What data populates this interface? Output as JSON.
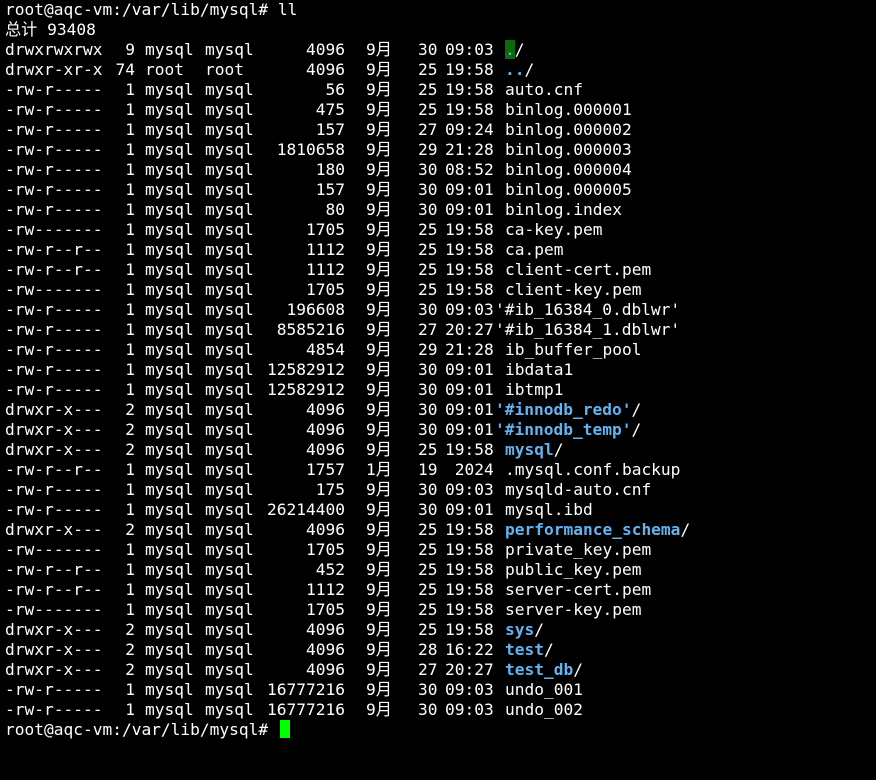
{
  "terminal": {
    "prompt": "root@aqc-vm:/var/lib/mysql#",
    "command": "ll",
    "total": "总计 93408",
    "entries": [
      {
        "perm": "drwxrwxrwx",
        "links": "9",
        "owner": "mysql",
        "group": "mysql",
        "size": "4096",
        "month": "9月",
        "day": "30",
        "time": "09:03",
        "name": ".",
        "suffix": "/",
        "type": "dir-current"
      },
      {
        "perm": "drwxr-xr-x",
        "links": "74",
        "owner": "root",
        "group": "root",
        "size": "4096",
        "month": "9月",
        "day": "25",
        "time": "19:58",
        "name": "..",
        "suffix": "/",
        "type": "dir"
      },
      {
        "perm": "-rw-r-----",
        "links": "1",
        "owner": "mysql",
        "group": "mysql",
        "size": "56",
        "month": "9月",
        "day": "25",
        "time": "19:58",
        "name": "auto.cnf",
        "suffix": "",
        "type": "file"
      },
      {
        "perm": "-rw-r-----",
        "links": "1",
        "owner": "mysql",
        "group": "mysql",
        "size": "475",
        "month": "9月",
        "day": "25",
        "time": "19:58",
        "name": "binlog.000001",
        "suffix": "",
        "type": "file"
      },
      {
        "perm": "-rw-r-----",
        "links": "1",
        "owner": "mysql",
        "group": "mysql",
        "size": "157",
        "month": "9月",
        "day": "27",
        "time": "09:24",
        "name": "binlog.000002",
        "suffix": "",
        "type": "file"
      },
      {
        "perm": "-rw-r-----",
        "links": "1",
        "owner": "mysql",
        "group": "mysql",
        "size": "1810658",
        "month": "9月",
        "day": "29",
        "time": "21:28",
        "name": "binlog.000003",
        "suffix": "",
        "type": "file"
      },
      {
        "perm": "-rw-r-----",
        "links": "1",
        "owner": "mysql",
        "group": "mysql",
        "size": "180",
        "month": "9月",
        "day": "30",
        "time": "08:52",
        "name": "binlog.000004",
        "suffix": "",
        "type": "file"
      },
      {
        "perm": "-rw-r-----",
        "links": "1",
        "owner": "mysql",
        "group": "mysql",
        "size": "157",
        "month": "9月",
        "day": "30",
        "time": "09:01",
        "name": "binlog.000005",
        "suffix": "",
        "type": "file"
      },
      {
        "perm": "-rw-r-----",
        "links": "1",
        "owner": "mysql",
        "group": "mysql",
        "size": "80",
        "month": "9月",
        "day": "30",
        "time": "09:01",
        "name": "binlog.index",
        "suffix": "",
        "type": "file"
      },
      {
        "perm": "-rw-------",
        "links": "1",
        "owner": "mysql",
        "group": "mysql",
        "size": "1705",
        "month": "9月",
        "day": "25",
        "time": "19:58",
        "name": "ca-key.pem",
        "suffix": "",
        "type": "file"
      },
      {
        "perm": "-rw-r--r--",
        "links": "1",
        "owner": "mysql",
        "group": "mysql",
        "size": "1112",
        "month": "9月",
        "day": "25",
        "time": "19:58",
        "name": "ca.pem",
        "suffix": "",
        "type": "file"
      },
      {
        "perm": "-rw-r--r--",
        "links": "1",
        "owner": "mysql",
        "group": "mysql",
        "size": "1112",
        "month": "9月",
        "day": "25",
        "time": "19:58",
        "name": "client-cert.pem",
        "suffix": "",
        "type": "file"
      },
      {
        "perm": "-rw-------",
        "links": "1",
        "owner": "mysql",
        "group": "mysql",
        "size": "1705",
        "month": "9月",
        "day": "25",
        "time": "19:58",
        "name": "client-key.pem",
        "suffix": "",
        "type": "file"
      },
      {
        "perm": "-rw-r-----",
        "links": "1",
        "owner": "mysql",
        "group": "mysql",
        "size": "196608",
        "month": "9月",
        "day": "30",
        "time": "09:03",
        "name": "'#ib_16384_0.dblwr'",
        "suffix": "",
        "type": "file-quoted"
      },
      {
        "perm": "-rw-r-----",
        "links": "1",
        "owner": "mysql",
        "group": "mysql",
        "size": "8585216",
        "month": "9月",
        "day": "27",
        "time": "20:27",
        "name": "'#ib_16384_1.dblwr'",
        "suffix": "",
        "type": "file-quoted"
      },
      {
        "perm": "-rw-r-----",
        "links": "1",
        "owner": "mysql",
        "group": "mysql",
        "size": "4854",
        "month": "9月",
        "day": "29",
        "time": "21:28",
        "name": "ib_buffer_pool",
        "suffix": "",
        "type": "file"
      },
      {
        "perm": "-rw-r-----",
        "links": "1",
        "owner": "mysql",
        "group": "mysql",
        "size": "12582912",
        "month": "9月",
        "day": "30",
        "time": "09:01",
        "name": "ibdata1",
        "suffix": "",
        "type": "file"
      },
      {
        "perm": "-rw-r-----",
        "links": "1",
        "owner": "mysql",
        "group": "mysql",
        "size": "12582912",
        "month": "9月",
        "day": "30",
        "time": "09:01",
        "name": "ibtmp1",
        "suffix": "",
        "type": "file"
      },
      {
        "perm": "drwxr-x---",
        "links": "2",
        "owner": "mysql",
        "group": "mysql",
        "size": "4096",
        "month": "9月",
        "day": "30",
        "time": "09:01",
        "name": "'#innodb_redo'",
        "suffix": "/",
        "type": "dir-quoted"
      },
      {
        "perm": "drwxr-x---",
        "links": "2",
        "owner": "mysql",
        "group": "mysql",
        "size": "4096",
        "month": "9月",
        "day": "30",
        "time": "09:01",
        "name": "'#innodb_temp'",
        "suffix": "/",
        "type": "dir-quoted"
      },
      {
        "perm": "drwxr-x---",
        "links": "2",
        "owner": "mysql",
        "group": "mysql",
        "size": "4096",
        "month": "9月",
        "day": "25",
        "time": "19:58",
        "name": "mysql",
        "suffix": "/",
        "type": "dir"
      },
      {
        "perm": "-rw-r--r--",
        "links": "1",
        "owner": "mysql",
        "group": "mysql",
        "size": "1757",
        "month": "1月",
        "day": "19",
        "time": " 2024",
        "name": ".mysql.conf.backup",
        "suffix": "",
        "type": "file"
      },
      {
        "perm": "-rw-r-----",
        "links": "1",
        "owner": "mysql",
        "group": "mysql",
        "size": "175",
        "month": "9月",
        "day": "30",
        "time": "09:03",
        "name": "mysqld-auto.cnf",
        "suffix": "",
        "type": "file"
      },
      {
        "perm": "-rw-r-----",
        "links": "1",
        "owner": "mysql",
        "group": "mysql",
        "size": "26214400",
        "month": "9月",
        "day": "30",
        "time": "09:01",
        "name": "mysql.ibd",
        "suffix": "",
        "type": "file"
      },
      {
        "perm": "drwxr-x---",
        "links": "2",
        "owner": "mysql",
        "group": "mysql",
        "size": "4096",
        "month": "9月",
        "day": "25",
        "time": "19:58",
        "name": "performance_schema",
        "suffix": "/",
        "type": "dir"
      },
      {
        "perm": "-rw-------",
        "links": "1",
        "owner": "mysql",
        "group": "mysql",
        "size": "1705",
        "month": "9月",
        "day": "25",
        "time": "19:58",
        "name": "private_key.pem",
        "suffix": "",
        "type": "file"
      },
      {
        "perm": "-rw-r--r--",
        "links": "1",
        "owner": "mysql",
        "group": "mysql",
        "size": "452",
        "month": "9月",
        "day": "25",
        "time": "19:58",
        "name": "public_key.pem",
        "suffix": "",
        "type": "file"
      },
      {
        "perm": "-rw-r--r--",
        "links": "1",
        "owner": "mysql",
        "group": "mysql",
        "size": "1112",
        "month": "9月",
        "day": "25",
        "time": "19:58",
        "name": "server-cert.pem",
        "suffix": "",
        "type": "file"
      },
      {
        "perm": "-rw-------",
        "links": "1",
        "owner": "mysql",
        "group": "mysql",
        "size": "1705",
        "month": "9月",
        "day": "25",
        "time": "19:58",
        "name": "server-key.pem",
        "suffix": "",
        "type": "file"
      },
      {
        "perm": "drwxr-x---",
        "links": "2",
        "owner": "mysql",
        "group": "mysql",
        "size": "4096",
        "month": "9月",
        "day": "25",
        "time": "19:58",
        "name": "sys",
        "suffix": "/",
        "type": "dir"
      },
      {
        "perm": "drwxr-x---",
        "links": "2",
        "owner": "mysql",
        "group": "mysql",
        "size": "4096",
        "month": "9月",
        "day": "28",
        "time": "16:22",
        "name": "test",
        "suffix": "/",
        "type": "dir"
      },
      {
        "perm": "drwxr-x---",
        "links": "2",
        "owner": "mysql",
        "group": "mysql",
        "size": "4096",
        "month": "9月",
        "day": "27",
        "time": "20:27",
        "name": "test_db",
        "suffix": "/",
        "type": "dir"
      },
      {
        "perm": "-rw-r-----",
        "links": "1",
        "owner": "mysql",
        "group": "mysql",
        "size": "16777216",
        "month": "9月",
        "day": "30",
        "time": "09:03",
        "name": "undo_001",
        "suffix": "",
        "type": "file"
      },
      {
        "perm": "-rw-r-----",
        "links": "1",
        "owner": "mysql",
        "group": "mysql",
        "size": "16777216",
        "month": "9月",
        "day": "30",
        "time": "09:03",
        "name": "undo_002",
        "suffix": "",
        "type": "file"
      }
    ]
  },
  "colors": {
    "background": "#000000",
    "text": "#ffffff",
    "directory": "#62b3f2",
    "cursor": "#00ff00",
    "current_dir_highlight": "#0b6b0b"
  }
}
